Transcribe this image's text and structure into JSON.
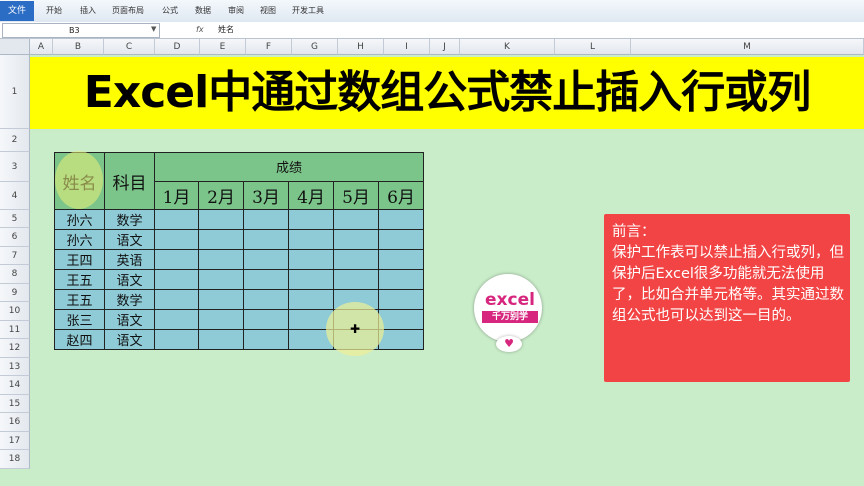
{
  "ribbon": {
    "file_tab": "文件",
    "tabs": [
      "开始",
      "插入",
      "页面布局",
      "公式",
      "数据",
      "审阅",
      "视图",
      "开发工具"
    ]
  },
  "formula_bar": {
    "name_box": "B3",
    "fx": "fx",
    "value": "姓名"
  },
  "columns": [
    "A",
    "B",
    "C",
    "D",
    "E",
    "F",
    "G",
    "H",
    "I",
    "J",
    "K",
    "L",
    "M"
  ],
  "rows": [
    "1",
    "2",
    "3",
    "4",
    "5",
    "6",
    "7",
    "8",
    "9",
    "10",
    "11",
    "12",
    "13",
    "14",
    "15",
    "16",
    "17",
    "18"
  ],
  "title": "Excel中通过数组公式禁止插入行或列",
  "table": {
    "header_name": "姓名",
    "header_subject": "科目",
    "header_score": "成绩",
    "months": [
      "1月",
      "2月",
      "3月",
      "4月",
      "5月",
      "6月"
    ],
    "records": [
      {
        "name": "孙六",
        "subject": "数学"
      },
      {
        "name": "孙六",
        "subject": "语文"
      },
      {
        "name": "王四",
        "subject": "英语"
      },
      {
        "name": "王五",
        "subject": "语文"
      },
      {
        "name": "王五",
        "subject": "数学"
      },
      {
        "name": "张三",
        "subject": "语文"
      },
      {
        "name": "赵四",
        "subject": "语文"
      }
    ]
  },
  "logo": {
    "word": "excel",
    "tagline": "千万别学"
  },
  "note": {
    "heading": "前言：",
    "body": "保护工作表可以禁止插入行或列，但保护后Excel很多功能就无法使用了，比如合并单元格等。其实通过数组公式也可以达到这一目的。"
  },
  "colors": {
    "title_bg": "#ffff00",
    "header_green": "#7bc48a",
    "body_blue": "#8ecbd6",
    "note_red": "#f24444",
    "logo_pink": "#d6267d"
  }
}
